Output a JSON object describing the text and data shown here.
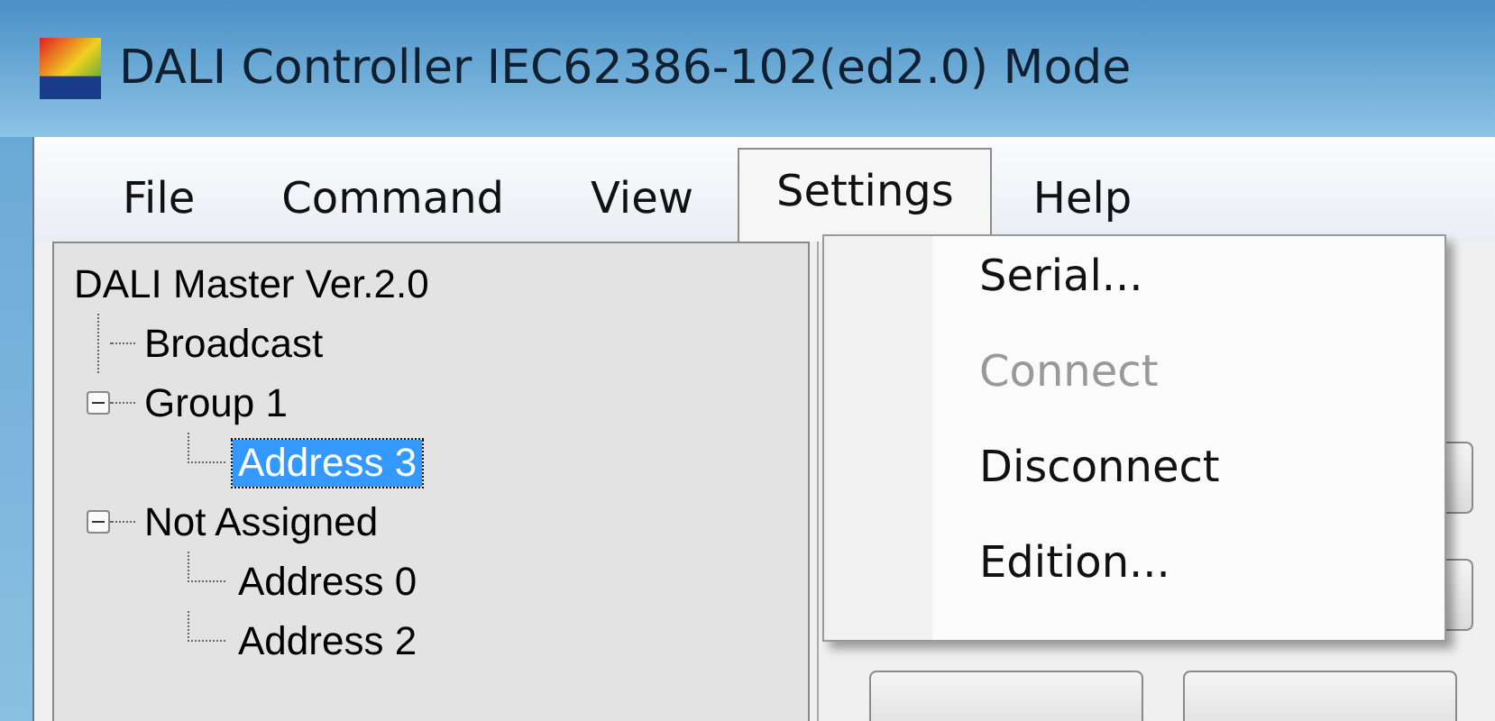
{
  "window": {
    "title": "DALI Controller IEC62386-102(ed2.0) Mode"
  },
  "menu_bar": [
    {
      "label": "File",
      "selected": false
    },
    {
      "label": "Command",
      "selected": false
    },
    {
      "label": "View",
      "selected": false
    },
    {
      "label": "Settings",
      "selected": true
    },
    {
      "label": "Help",
      "selected": false
    }
  ],
  "settings_menu": [
    {
      "label": "Serial...",
      "disabled": false
    },
    {
      "label": "Connect",
      "disabled": true
    },
    {
      "label": "Disconnect",
      "disabled": false
    },
    {
      "label": "Edition...",
      "disabled": false
    }
  ],
  "tree": {
    "label": "DALI Master Ver.2.0",
    "children": [
      {
        "label": "Broadcast",
        "selected": false
      },
      {
        "label": "Group 1",
        "selected": false,
        "expanded": true,
        "children": [
          {
            "label": "Address 3",
            "selected": true
          }
        ]
      },
      {
        "label": "Not Assigned",
        "selected": false,
        "expanded": true,
        "children": [
          {
            "label": "Address 0",
            "selected": false
          },
          {
            "label": "Address 2",
            "selected": false
          }
        ]
      }
    ]
  }
}
